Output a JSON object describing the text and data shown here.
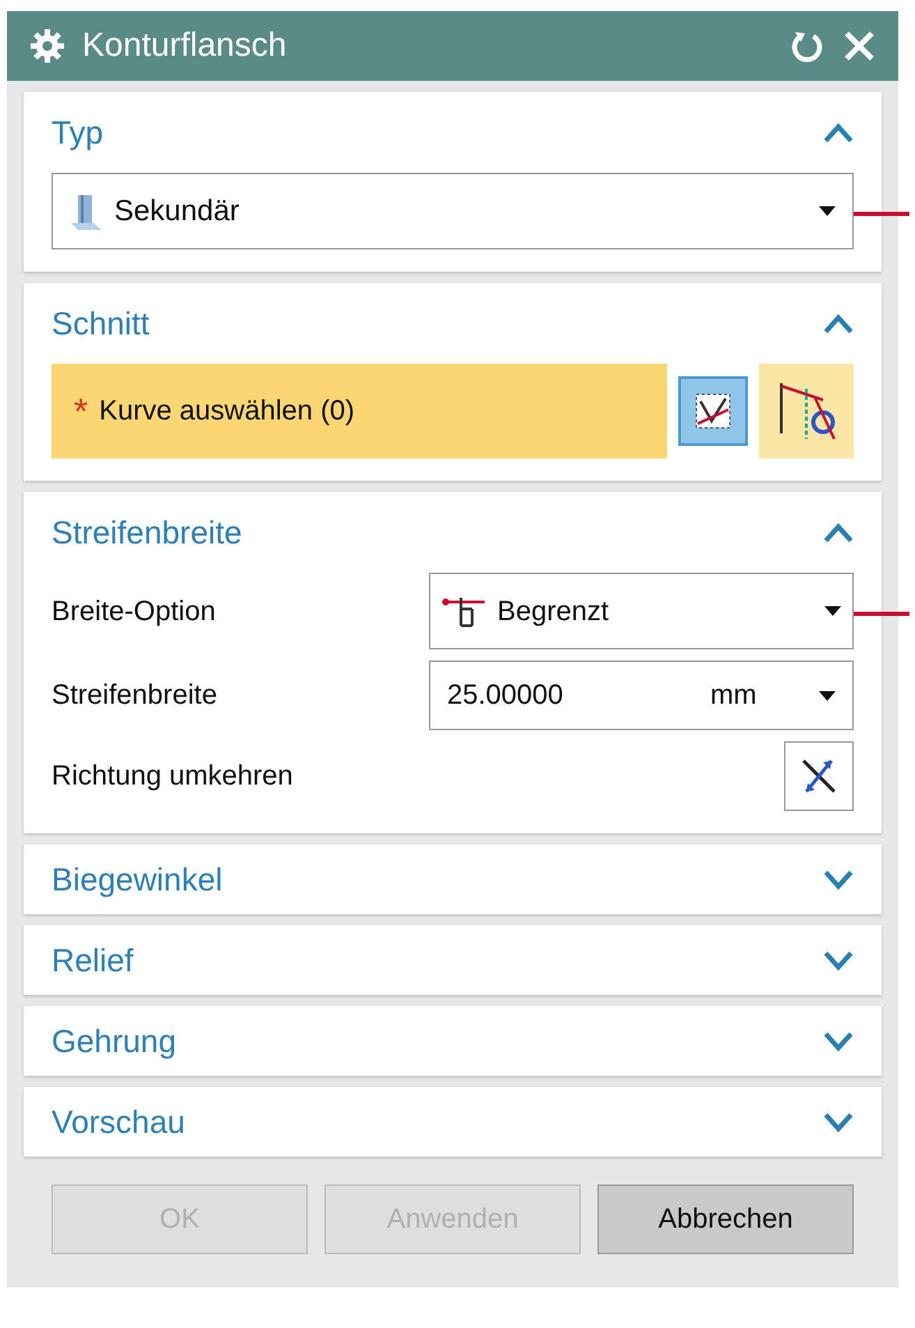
{
  "window": {
    "title": "Konturflansch"
  },
  "sections": [
    {
      "title": "Typ",
      "expanded": true,
      "kind": "type",
      "dropdown": {
        "value": "Sekundär"
      }
    },
    {
      "title": "Schnitt",
      "expanded": true,
      "kind": "selection",
      "prompt": "Kurve auswählen (0)",
      "required_mark": "*"
    },
    {
      "title": "Streifenbreite",
      "expanded": true,
      "kind": "width",
      "rows": [
        {
          "label": "Breite-Option",
          "kind": "dropdown",
          "value": "Begrenzt"
        },
        {
          "label": "Streifenbreite",
          "kind": "number",
          "value": "25.00000",
          "unit": "mm"
        },
        {
          "label": "Richtung umkehren",
          "kind": "toggle"
        }
      ]
    },
    {
      "title": "Biegewinkel",
      "expanded": false
    },
    {
      "title": "Relief",
      "expanded": false
    },
    {
      "title": "Gehrung",
      "expanded": false
    },
    {
      "title": "Vorschau",
      "expanded": false
    }
  ],
  "buttons": [
    {
      "label": "OK",
      "disabled": true
    },
    {
      "label": "Anwenden",
      "disabled": true
    },
    {
      "label": "Abbrechen",
      "disabled": false
    }
  ]
}
